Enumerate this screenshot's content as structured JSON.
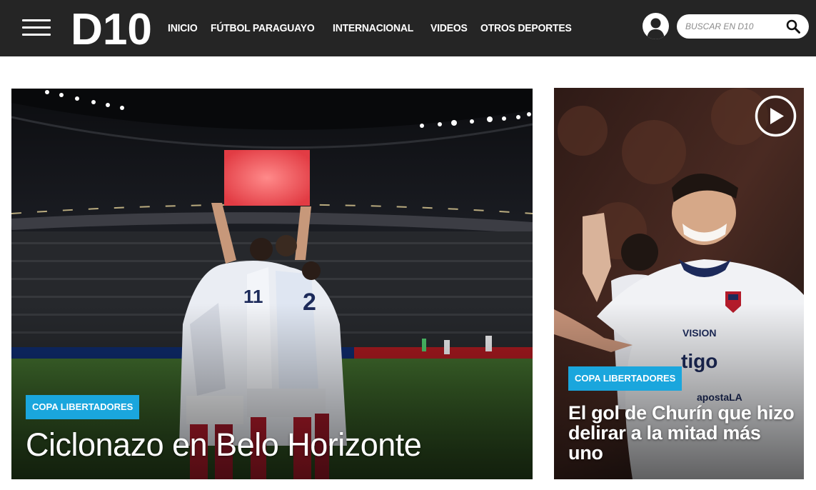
{
  "header": {
    "logo_text": "D10",
    "nav": [
      "INICIO",
      "FÚTBOL PARAGUAYO",
      "INTERNACIONAL",
      "VIDEOS",
      "OTROS DEPORTES"
    ],
    "search_placeholder": "BUSCAR EN D10",
    "icons": {
      "menu": "hamburger-menu-icon",
      "user": "user-icon",
      "search": "search-icon"
    }
  },
  "main_story": {
    "category": "COPA LIBERTADORES",
    "title": "Ciclonazo en Belo Horizonte"
  },
  "side_story": {
    "category": "COPA LIBERTADORES",
    "title": "El gol de Churín que hizo delirar a la mitad más uno",
    "media_icon": "play-video-icon"
  },
  "colors": {
    "header_bg": "#252525",
    "tag_bg": "#1aa6dd",
    "text_on_image": "#ffffff"
  }
}
